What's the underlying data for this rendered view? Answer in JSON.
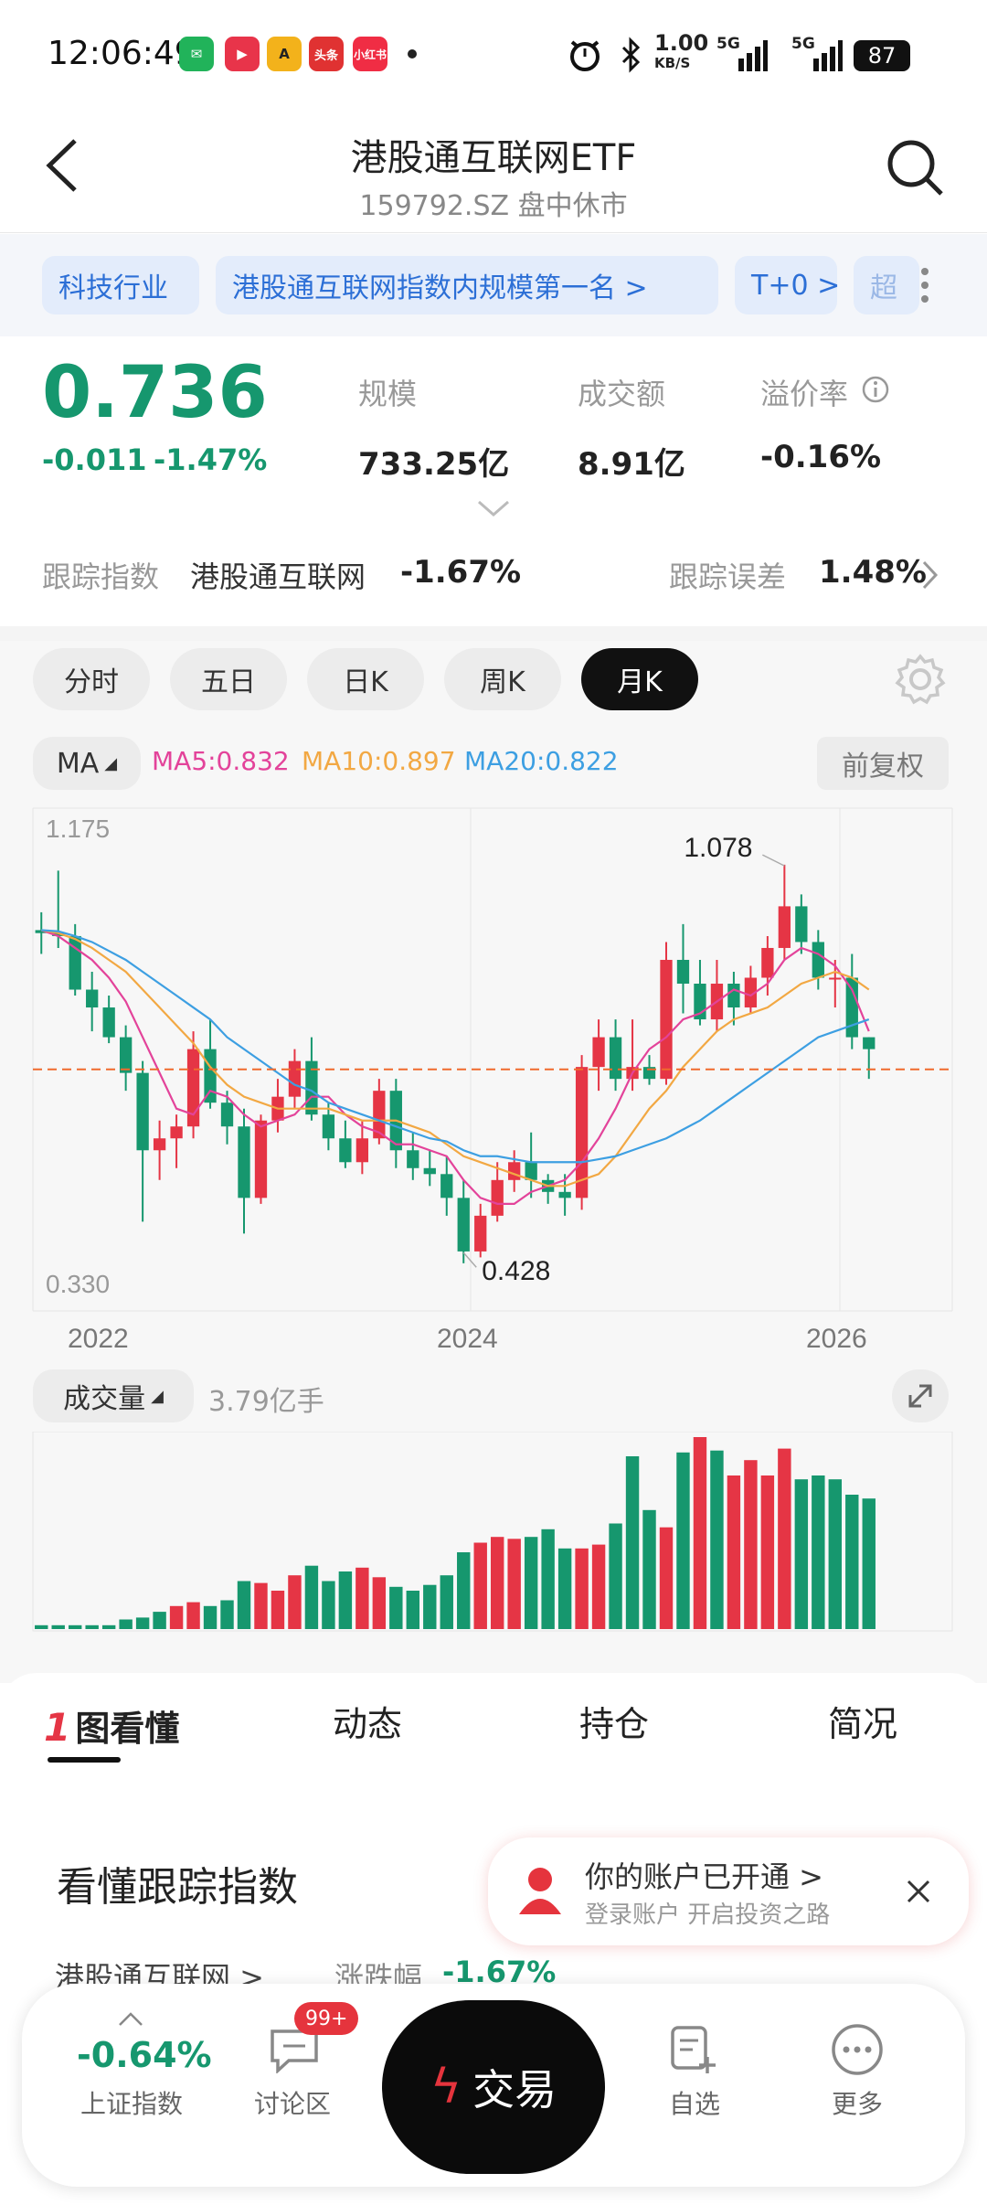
{
  "status": {
    "time": "12:06:49",
    "apps": [
      "微信",
      "爱奇艺",
      "A",
      "头条",
      "小红书"
    ],
    "net_speed_value": "1.00",
    "net_speed_unit": "KB/S",
    "signal1": "5G",
    "signal2": "5G",
    "battery": "87"
  },
  "header": {
    "title": "港股通互联网ETF",
    "subtitle": "159792.SZ 盘中休市"
  },
  "tags": [
    "科技行业",
    "港股通互联网指数内规模第一名 >",
    "T+0 >",
    "超"
  ],
  "quote": {
    "price": "0.736",
    "change": "-0.011",
    "change_pct": "-1.47%",
    "scale_label": "规模",
    "scale_value": "733.25亿",
    "turnover_label": "成交额",
    "turnover_value": "8.91亿",
    "premium_label": "溢价率",
    "premium_value": "-0.16%",
    "track_label": "跟踪指数",
    "track_name": "港股通互联网",
    "track_pct": "-1.67%",
    "track_error_label": "跟踪误差",
    "track_error_value": "1.48%"
  },
  "periods": [
    {
      "label": "分时",
      "active": false
    },
    {
      "label": "五日",
      "active": false
    },
    {
      "label": "日K",
      "active": false
    },
    {
      "label": "周K",
      "active": false
    },
    {
      "label": "月K",
      "active": true
    }
  ],
  "ma": {
    "selector": "MA",
    "ma5": "MA5:0.832",
    "ma10": "MA10:0.897",
    "ma20": "MA20:0.822",
    "adjust": "前复权",
    "colors": {
      "ma5": "#e3439a",
      "ma10": "#f2a843",
      "ma20": "#3d9fe2",
      "up": "#e53545",
      "down": "#16976e"
    }
  },
  "chart_data": {
    "type": "candlestick",
    "ylim": [
      0.33,
      1.175
    ],
    "y_labels": [
      "1.175",
      "0.330"
    ],
    "x_tick_labels": [
      "2022",
      "2024",
      "2026"
    ],
    "annotations": [
      {
        "text": "1.078",
        "value": 1.078
      },
      {
        "text": "0.428",
        "value": 0.428
      }
    ],
    "reference_line": 0.736,
    "candles": [
      [
        0.97,
        0.965,
        1.0,
        0.93
      ],
      [
        0.965,
        0.96,
        1.07,
        0.94
      ],
      [
        0.96,
        0.87,
        0.98,
        0.86
      ],
      [
        0.87,
        0.84,
        0.9,
        0.8
      ],
      [
        0.84,
        0.79,
        0.86,
        0.78
      ],
      [
        0.79,
        0.73,
        0.81,
        0.7
      ],
      [
        0.73,
        0.6,
        0.75,
        0.48
      ],
      [
        0.6,
        0.62,
        0.65,
        0.55
      ],
      [
        0.62,
        0.64,
        0.66,
        0.57
      ],
      [
        0.64,
        0.77,
        0.8,
        0.62
      ],
      [
        0.77,
        0.68,
        0.82,
        0.67
      ],
      [
        0.68,
        0.64,
        0.7,
        0.61
      ],
      [
        0.64,
        0.52,
        0.67,
        0.46
      ],
      [
        0.52,
        0.65,
        0.66,
        0.51
      ],
      [
        0.65,
        0.69,
        0.72,
        0.63
      ],
      [
        0.69,
        0.75,
        0.77,
        0.67
      ],
      [
        0.75,
        0.66,
        0.79,
        0.65
      ],
      [
        0.66,
        0.62,
        0.68,
        0.6
      ],
      [
        0.62,
        0.58,
        0.65,
        0.57
      ],
      [
        0.58,
        0.62,
        0.65,
        0.56
      ],
      [
        0.62,
        0.7,
        0.72,
        0.61
      ],
      [
        0.7,
        0.6,
        0.72,
        0.57
      ],
      [
        0.6,
        0.57,
        0.63,
        0.55
      ],
      [
        0.57,
        0.56,
        0.6,
        0.54
      ],
      [
        0.56,
        0.52,
        0.59,
        0.49
      ],
      [
        0.52,
        0.43,
        0.55,
        0.41
      ],
      [
        0.43,
        0.49,
        0.51,
        0.42
      ],
      [
        0.49,
        0.55,
        0.58,
        0.48
      ],
      [
        0.55,
        0.58,
        0.6,
        0.53
      ],
      [
        0.58,
        0.55,
        0.63,
        0.52
      ],
      [
        0.55,
        0.53,
        0.56,
        0.51
      ],
      [
        0.53,
        0.52,
        0.56,
        0.49
      ],
      [
        0.52,
        0.74,
        0.76,
        0.5
      ],
      [
        0.74,
        0.79,
        0.82,
        0.7
      ],
      [
        0.79,
        0.72,
        0.82,
        0.7
      ],
      [
        0.72,
        0.74,
        0.82,
        0.7
      ],
      [
        0.74,
        0.72,
        0.76,
        0.71
      ],
      [
        0.72,
        0.92,
        0.95,
        0.71
      ],
      [
        0.92,
        0.88,
        0.98,
        0.83
      ],
      [
        0.88,
        0.82,
        0.92,
        0.81
      ],
      [
        0.82,
        0.88,
        0.92,
        0.8
      ],
      [
        0.88,
        0.84,
        0.9,
        0.81
      ],
      [
        0.84,
        0.89,
        0.91,
        0.83
      ],
      [
        0.89,
        0.94,
        0.96,
        0.86
      ],
      [
        0.94,
        1.01,
        1.08,
        0.92
      ],
      [
        1.01,
        0.95,
        1.03,
        0.93
      ],
      [
        0.95,
        0.89,
        0.97,
        0.87
      ],
      [
        0.89,
        0.89,
        0.92,
        0.84
      ],
      [
        0.89,
        0.79,
        0.93,
        0.77
      ],
      [
        0.79,
        0.77,
        0.79,
        0.72
      ]
    ],
    "ma5": [
      0.97,
      0.96,
      0.94,
      0.92,
      0.89,
      0.85,
      0.79,
      0.73,
      0.67,
      0.66,
      0.7,
      0.69,
      0.66,
      0.64,
      0.65,
      0.66,
      0.69,
      0.69,
      0.66,
      0.64,
      0.63,
      0.61,
      0.61,
      0.6,
      0.59,
      0.55,
      0.52,
      0.51,
      0.51,
      0.53,
      0.54,
      0.55,
      0.58,
      0.62,
      0.67,
      0.73,
      0.77,
      0.79,
      0.82,
      0.83,
      0.85,
      0.87,
      0.86,
      0.88,
      0.92,
      0.94,
      0.93,
      0.91,
      0.87,
      0.8
    ],
    "ma10": [
      0.97,
      0.965,
      0.955,
      0.94,
      0.92,
      0.9,
      0.87,
      0.84,
      0.81,
      0.78,
      0.74,
      0.71,
      0.69,
      0.68,
      0.67,
      0.67,
      0.67,
      0.67,
      0.66,
      0.65,
      0.65,
      0.65,
      0.64,
      0.63,
      0.61,
      0.59,
      0.58,
      0.57,
      0.56,
      0.55,
      0.54,
      0.54,
      0.55,
      0.56,
      0.59,
      0.63,
      0.67,
      0.7,
      0.74,
      0.77,
      0.8,
      0.82,
      0.83,
      0.84,
      0.86,
      0.88,
      0.89,
      0.9,
      0.89,
      0.87
    ],
    "ma20": [
      0.97,
      0.968,
      0.96,
      0.95,
      0.935,
      0.92,
      0.9,
      0.88,
      0.86,
      0.84,
      0.82,
      0.79,
      0.77,
      0.75,
      0.73,
      0.71,
      0.7,
      0.68,
      0.67,
      0.66,
      0.65,
      0.64,
      0.63,
      0.62,
      0.615,
      0.6,
      0.59,
      0.59,
      0.585,
      0.58,
      0.58,
      0.58,
      0.58,
      0.585,
      0.59,
      0.6,
      0.61,
      0.62,
      0.635,
      0.65,
      0.67,
      0.69,
      0.71,
      0.73,
      0.75,
      0.77,
      0.79,
      0.8,
      0.81,
      0.82
    ]
  },
  "volume": {
    "label": "成交量",
    "value": "3.79亿手",
    "bars": [
      0.02,
      0.02,
      0.02,
      0.02,
      0.02,
      0.05,
      0.06,
      0.09,
      0.12,
      0.14,
      0.12,
      0.15,
      0.25,
      0.24,
      0.2,
      0.28,
      0.33,
      0.25,
      0.3,
      0.32,
      0.27,
      0.22,
      0.2,
      0.23,
      0.28,
      0.4,
      0.45,
      0.48,
      0.47,
      0.48,
      0.52,
      0.42,
      0.42,
      0.44,
      0.55,
      0.9,
      0.62,
      0.53,
      0.92,
      1.0,
      0.93,
      0.8,
      0.88,
      0.8,
      0.94,
      0.78,
      0.8,
      0.78,
      0.7,
      0.68
    ],
    "up": [
      false,
      false,
      false,
      false,
      false,
      false,
      false,
      false,
      true,
      true,
      false,
      false,
      false,
      true,
      true,
      true,
      false,
      false,
      false,
      true,
      true,
      false,
      false,
      false,
      false,
      false,
      true,
      true,
      true,
      false,
      false,
      false,
      true,
      true,
      false,
      false,
      false,
      true,
      false,
      true,
      false,
      true,
      true,
      true,
      true,
      false,
      false,
      false,
      false,
      false
    ]
  },
  "tabs": [
    "图看懂",
    "动态",
    "持仓",
    "简况"
  ],
  "section": {
    "title": "看懂跟踪指数",
    "sub_name": "港股通互联网 >",
    "sub_label": "涨跌幅",
    "sub_value": "-1.67%"
  },
  "toast": {
    "title": "你的账户已开通 >",
    "subtitle": "登录账户 开启投资之路"
  },
  "bottom": {
    "index_value": "-0.64%",
    "index_label": "上证指数",
    "forum_badge": "99+",
    "forum_label": "讨论区",
    "trade_label": "交易",
    "watch_label": "自选",
    "more_label": "更多"
  }
}
